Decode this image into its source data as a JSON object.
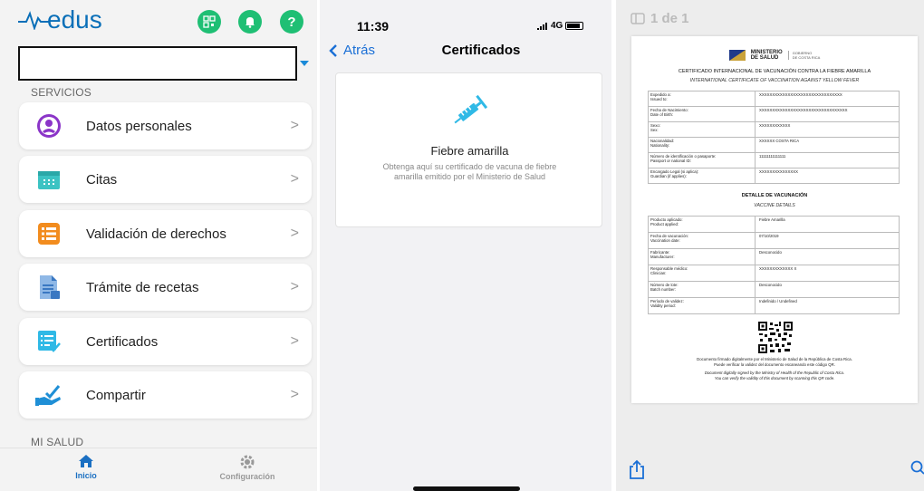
{
  "panel1": {
    "brand": "edus",
    "dropdown_value": "",
    "sections": {
      "services": "SERVICIOS",
      "health": "MI SALUD"
    },
    "menu": [
      {
        "label": "Datos personales",
        "icon": "user-circle-icon",
        "color": "#8b35c8"
      },
      {
        "label": "Citas",
        "icon": "calendar-icon",
        "color": "#3cc3c3"
      },
      {
        "label": "Validación de derechos",
        "icon": "list-icon",
        "color": "#f28c1e"
      },
      {
        "label": "Trámite de recetas",
        "icon": "prescription-icon",
        "color": "#3a78c2"
      },
      {
        "label": "Certificados",
        "icon": "certificate-icon",
        "color": "#2fb9e6"
      },
      {
        "label": "Compartir",
        "icon": "share-hand-icon",
        "color": "#1f8fd6"
      }
    ],
    "tabs": {
      "home": "Inicio",
      "settings": "Configuración"
    },
    "colors": {
      "accent": "#1a6fc2",
      "green": "#1fbf74"
    }
  },
  "panel2": {
    "time": "11:39",
    "network": "4G",
    "back_label": "Atrás",
    "title": "Certificados",
    "card": {
      "title": "Fiebre amarilla",
      "description": "Obtenga aquí su certificado de vacuna de fiebre amarilla emitido por el Ministerio de Salud"
    },
    "colors": {
      "link": "#1a6fd6",
      "icon": "#2fb9e6"
    }
  },
  "panel3": {
    "page_indicator": "1 de 1",
    "ministry": {
      "line1": "MINISTERIO",
      "line2": "DE SALUD",
      "gov1": "GOBIERNO",
      "gov2": "DE COSTA RICA"
    },
    "title": "CERTIFICADO INTERNACIONAL DE VACUNACIÓN CONTRA LA FIEBRE AMARILLA",
    "subtitle": "INTERNATIONAL CERTIFICATE OF VACCINATION AGAINST YELLOW FEVER",
    "personal_rows": [
      {
        "k1": "Expedido a:",
        "k2": "Issued to:",
        "v": "XXXXXXXXXXXXXXXXXXXXXXXXXXXXXXXX"
      },
      {
        "k1": "Fecha de Nacimiento:",
        "k2": "Date of Birth:",
        "v": "XXXXXXXXXXXXXXXXXXXXXXXXXXXXXXXXXX"
      },
      {
        "k1": "Sexo:",
        "k2": "Sex:",
        "v": "XXXXXXXXXXXX"
      },
      {
        "k1": "Nacionalidad:",
        "k2": "Nationality:",
        "v": "XXXXXX COSTA RICA"
      },
      {
        "k1": "Número de identificación o pasaporte:",
        "k2": "Passport or national ID:",
        "v": "11111111111111"
      },
      {
        "k1": "Encargado Legal (si aplica):",
        "k2": "Guardian (if applies):",
        "v": "XXXXXXXXXXXXXXX"
      }
    ],
    "details_title": "DETALLE DE VACUNACIÓN",
    "details_subtitle": "VACCINE DETAILS",
    "vaccine_rows": [
      {
        "k1": "Producto aplicado:",
        "k2": "Product applied:",
        "v": "Fiebre Amarilla"
      },
      {
        "k1": "Fecha de vacunación:",
        "k2": "Vaccination date:",
        "v": "07/10/2019"
      },
      {
        "k1": "Fabricante:",
        "k2": "Manufacturer:",
        "v": "Desconocido"
      },
      {
        "k1": "Responsable médico:",
        "k2": "Clinician:",
        "v": "XXXXXXXXXXXXX X"
      },
      {
        "k1": "Número de lote:",
        "k2": "Batch number:",
        "v": "Desconocido"
      },
      {
        "k1": "Período de validez:",
        "k2": "Validity period:",
        "v": "Indefinido / Undefined"
      }
    ],
    "footer": {
      "es1": "Documento firmado digitalmente por el Ministerio de Salud de la República de Costa Rica.",
      "es2": "Puede verificar la validez del documento escaneando este código QR.",
      "en1": "Document digitally signed by the Ministry of Health of the Republic of Costa Rica.",
      "en2": "You can verify the validity of this document by scanning this QR code."
    }
  }
}
